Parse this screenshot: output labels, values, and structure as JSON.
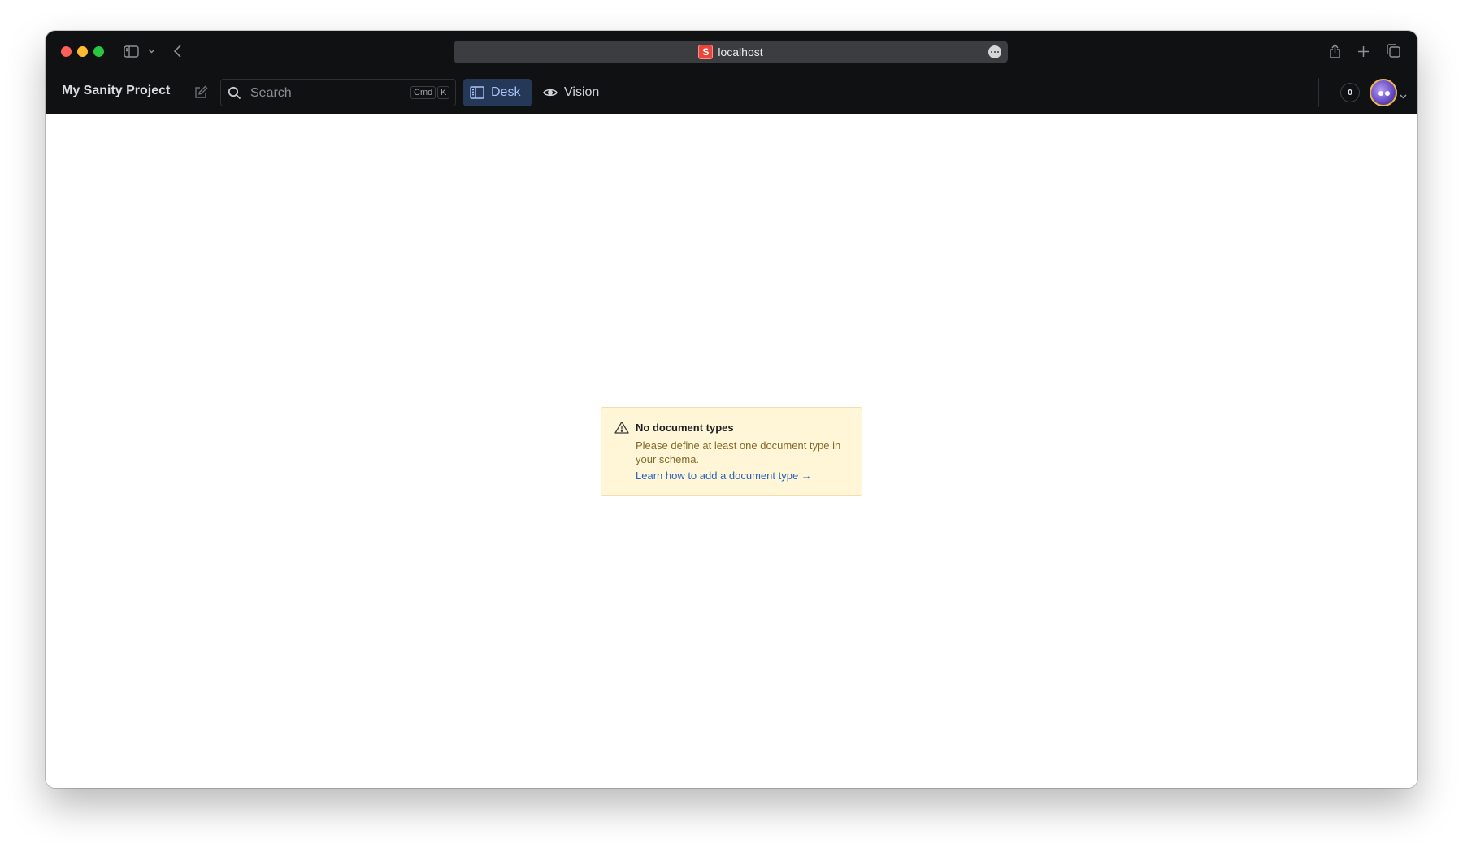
{
  "browser": {
    "url": "localhost",
    "favicon_letter": "S"
  },
  "studio": {
    "project_title": "My Sanity Project",
    "search": {
      "placeholder": "Search",
      "shortcut_cmd": "Cmd",
      "shortcut_key": "K"
    },
    "tools": [
      {
        "label": "Desk",
        "icon": "desk-icon",
        "active": true
      },
      {
        "label": "Vision",
        "icon": "eye-icon",
        "active": false
      }
    ],
    "presence_count": "0"
  },
  "notice": {
    "title": "No document types",
    "body": "Please define at least one document type in your schema.",
    "link": "Learn how to add a document type →"
  },
  "colors": {
    "chrome_bg": "#101112",
    "active_tool_bg": "#263858",
    "active_tool_text": "#a9c4f5",
    "notice_bg": "#fff6d8",
    "notice_text": "#806b28",
    "link": "#2a63b8"
  }
}
